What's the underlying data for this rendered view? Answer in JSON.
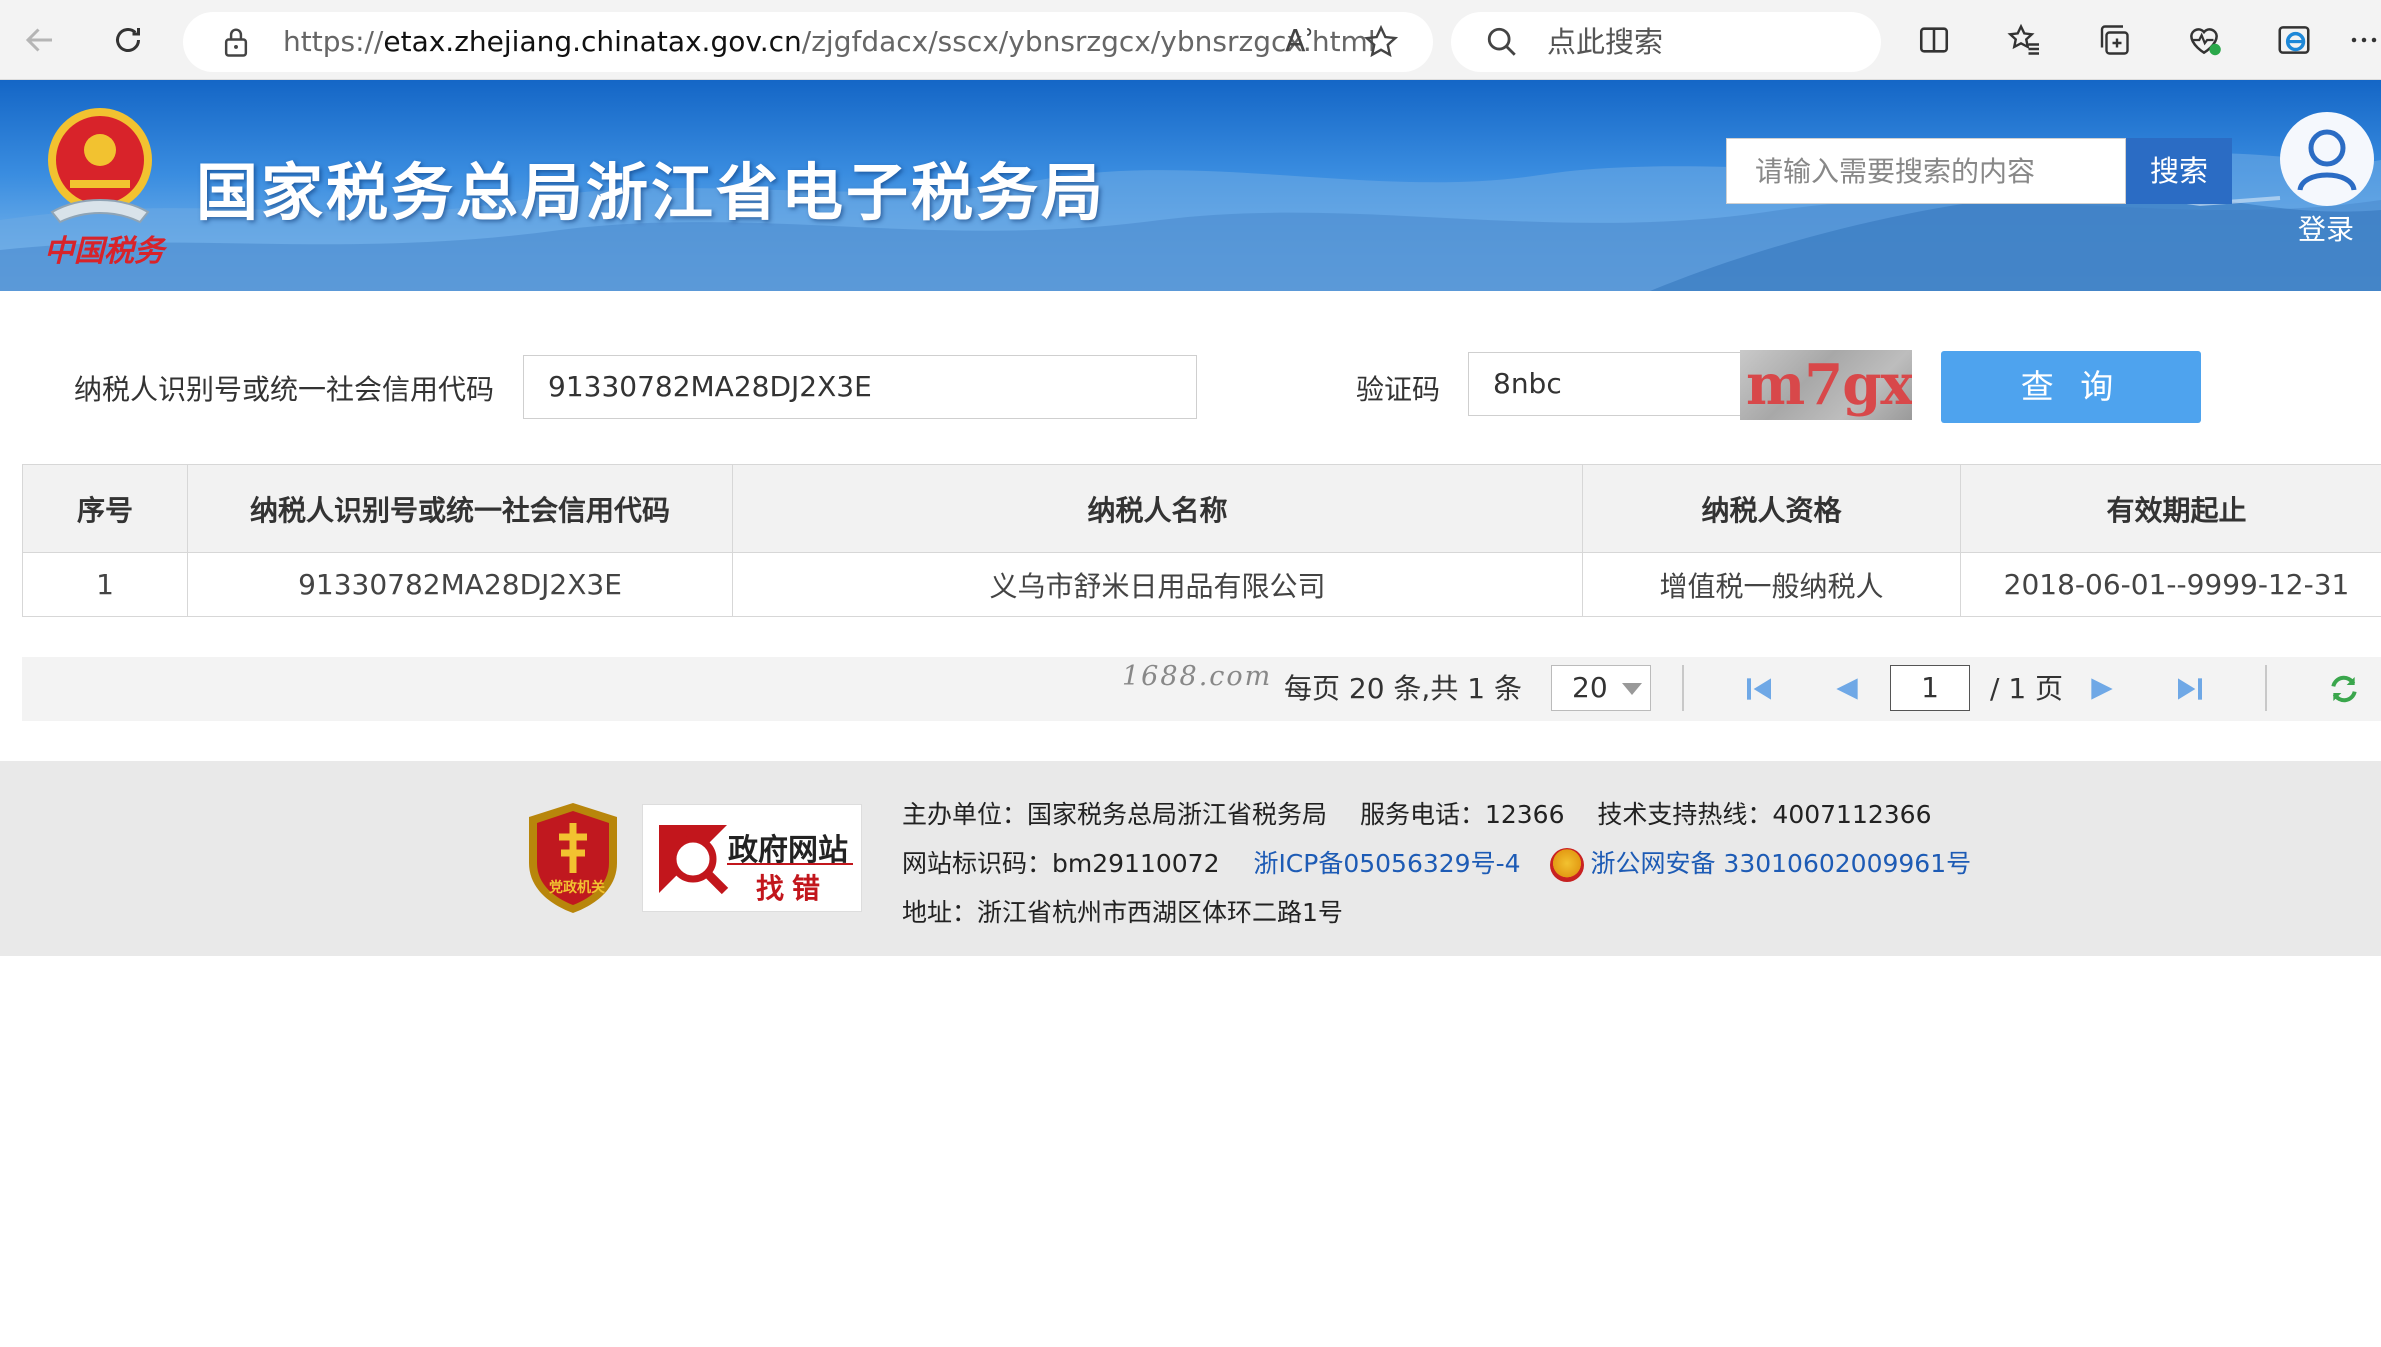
{
  "browser": {
    "url_scheme": "https://",
    "url_host": "etax.zhejiang.chinatax.gov.cn",
    "url_path": "/zjgfdacx/sscx/ybnsrzgcx/ybnsrzgcx.html",
    "search_placeholder": "点此搜索",
    "read_aloud_label": "Aʾ"
  },
  "header": {
    "site_title": "国家税务总局浙江省电子税务局",
    "emblem_text": "中国税务",
    "search_placeholder": "请输入需要搜索的内容",
    "search_button": "搜索",
    "login_label": "登录"
  },
  "form": {
    "taxpayer_id_label": "纳税人识别号或统一社会信用代码",
    "taxpayer_id_value": "91330782MA28DJ2X3E",
    "captcha_label": "验证码",
    "captcha_input_value": "8nbc",
    "captcha_image_text": "m7gx",
    "query_button": "查 询"
  },
  "table": {
    "headers": [
      "序号",
      "纳税人识别号或统一社会信用代码",
      "纳税人名称",
      "纳税人资格",
      "有效期起止"
    ],
    "rows": [
      [
        "1",
        "91330782MA28DJ2X3E",
        "义乌市舒米日用品有限公司",
        "增值税一般纳税人",
        "2018-06-01--9999-12-31"
      ]
    ]
  },
  "pager": {
    "watermark": "1688.com",
    "info": "每页 20 条,共 1 条",
    "page_size": "20",
    "current_page": "1",
    "total_pages": "/ 1 页"
  },
  "footer": {
    "badge_party_label": "党政机关",
    "badge_gov_line1": "政府网站",
    "badge_gov_line2": "找错",
    "line1": "主办单位：国家税务总局浙江省税务局　 服务电话：12366　 技术支持热线：4007112366",
    "site_code": "网站标识码：bm29110072",
    "icp": "浙ICP备05056329号-4",
    "police": "浙公网安备 33010602009961号",
    "address": "地址：浙江省杭州市西湖区体环二路1号"
  },
  "colors": {
    "banner_blue": "#1466c6",
    "query_button": "#4ea3ee",
    "search_button": "#2b6cc4",
    "link_blue": "#1d5bb5",
    "pager_icon_blue": "#6fa8e6",
    "refresh_green": "#3aa64c"
  }
}
